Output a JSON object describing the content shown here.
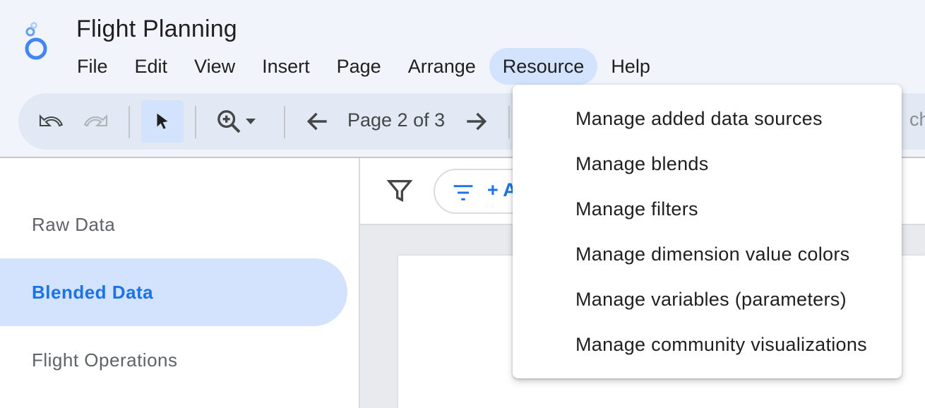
{
  "app": {
    "title": "Flight Planning"
  },
  "menu": {
    "items": [
      "File",
      "Edit",
      "View",
      "Insert",
      "Page",
      "Arrange",
      "Resource",
      "Help"
    ],
    "active": "Resource"
  },
  "toolbar": {
    "page_label": "Page 2 of 3",
    "cut_text": "cha",
    "icons": [
      "undo-icon",
      "redo-icon",
      "select-pointer-icon",
      "zoom-icon",
      "dropdown-arrow-icon",
      "prev-page-icon",
      "next-page-icon"
    ]
  },
  "sidebar": {
    "pages": [
      {
        "label": "Raw Data"
      },
      {
        "label": "Blended Data"
      },
      {
        "label": "Flight Operations"
      }
    ],
    "active_index": 1
  },
  "filter_bar": {
    "add_filter_text": "+ A"
  },
  "resource_menu": {
    "items": [
      {
        "label": "Manage added data sources"
      },
      {
        "label": "Manage blends"
      },
      {
        "label": "Manage filters"
      },
      {
        "label": "Manage dimension value colors"
      },
      {
        "label": "Manage variables (parameters)"
      },
      {
        "label": "Manage community visualizations"
      }
    ]
  },
  "colors": {
    "accent": "#1a73e8",
    "active_bg": "#d3e3fd",
    "header_bg": "#f1f4fb",
    "toolbar_bg": "#e2e8f4"
  }
}
